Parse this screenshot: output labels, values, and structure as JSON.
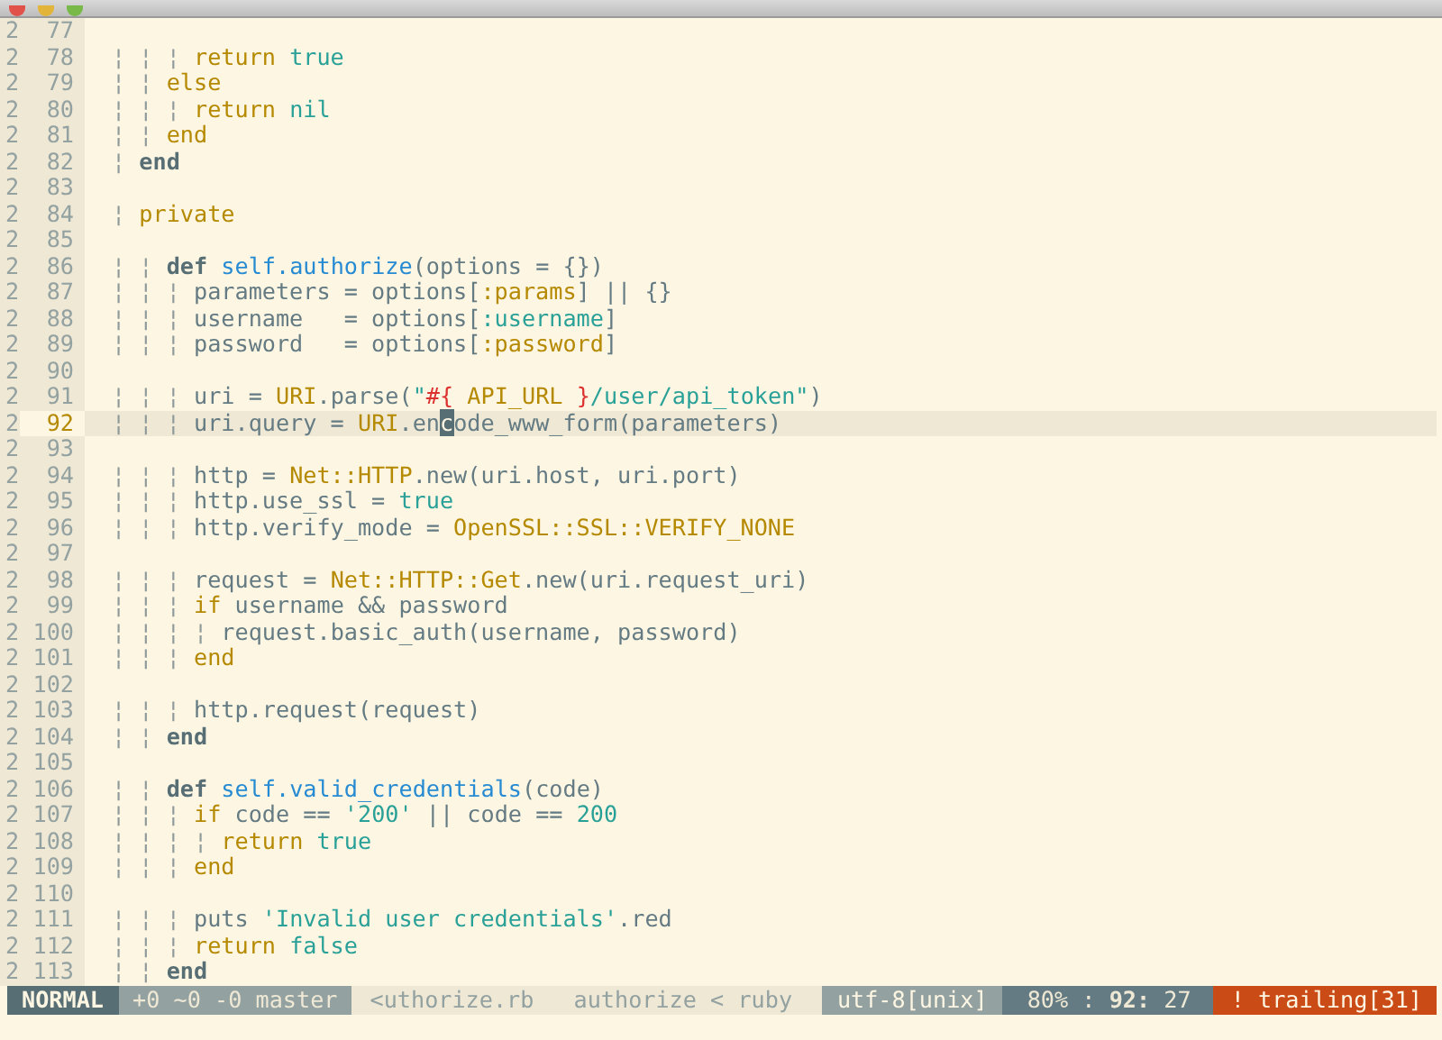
{
  "editor": {
    "lines": [
      {
        "sign": "2",
        "number": "77",
        "current": false
      },
      {
        "sign": "2",
        "number": "78",
        "current": false,
        "tokens": [
          {
            "kind": "guide",
            "text": "¦ ¦ ¦ "
          },
          {
            "kind": "keyword",
            "text": "return "
          },
          {
            "kind": "boolean",
            "text": "true"
          }
        ]
      },
      {
        "sign": "2",
        "number": "79",
        "current": false,
        "tokens": [
          {
            "kind": "guide",
            "text": "¦ ¦ "
          },
          {
            "kind": "keyword",
            "text": "else"
          }
        ]
      },
      {
        "sign": "2",
        "number": "80",
        "current": false,
        "tokens": [
          {
            "kind": "guide",
            "text": "¦ ¦ ¦ "
          },
          {
            "kind": "keyword",
            "text": "return "
          },
          {
            "kind": "boolean",
            "text": "nil"
          }
        ]
      },
      {
        "sign": "2",
        "number": "81",
        "current": false,
        "tokens": [
          {
            "kind": "guide",
            "text": "¦ ¦ "
          },
          {
            "kind": "keyword",
            "text": "end"
          }
        ]
      },
      {
        "sign": "2",
        "number": "82",
        "current": false,
        "tokens": [
          {
            "kind": "guide",
            "text": "¦ "
          },
          {
            "kind": "define",
            "text": "end"
          }
        ]
      },
      {
        "sign": "2",
        "number": "83",
        "current": false
      },
      {
        "sign": "2",
        "number": "84",
        "current": false,
        "tokens": [
          {
            "kind": "guide",
            "text": "¦ "
          },
          {
            "kind": "keyword",
            "text": "private"
          }
        ]
      },
      {
        "sign": "2",
        "number": "85",
        "current": false
      },
      {
        "sign": "2",
        "number": "86",
        "current": false,
        "tokens": [
          {
            "kind": "guide",
            "text": "¦ ¦ "
          },
          {
            "kind": "define",
            "text": "def "
          },
          {
            "kind": "method",
            "text": "self.authorize"
          },
          {
            "kind": "plain",
            "text": "(options = {})"
          }
        ]
      },
      {
        "sign": "2",
        "number": "87",
        "current": false,
        "tokens": [
          {
            "kind": "guide",
            "text": "¦ ¦ ¦ "
          },
          {
            "kind": "plain",
            "text": "parameters = options["
          },
          {
            "kind": "constant",
            "text": ":params"
          },
          {
            "kind": "plain",
            "text": "] || {}"
          }
        ]
      },
      {
        "sign": "2",
        "number": "88",
        "current": false,
        "tokens": [
          {
            "kind": "guide",
            "text": "¦ ¦ ¦ "
          },
          {
            "kind": "plain",
            "text": "username   = options["
          },
          {
            "kind": "boolean",
            "text": ":username"
          },
          {
            "kind": "plain",
            "text": "]"
          }
        ]
      },
      {
        "sign": "2",
        "number": "89",
        "current": false,
        "tokens": [
          {
            "kind": "guide",
            "text": "¦ ¦ ¦ "
          },
          {
            "kind": "plain",
            "text": "password   = options["
          },
          {
            "kind": "constant",
            "text": ":password"
          },
          {
            "kind": "plain",
            "text": "]"
          }
        ]
      },
      {
        "sign": "2",
        "number": "90",
        "current": false
      },
      {
        "sign": "2",
        "number": "91",
        "current": false,
        "tokens": [
          {
            "kind": "guide",
            "text": "¦ ¦ ¦ "
          },
          {
            "kind": "plain",
            "text": "uri = "
          },
          {
            "kind": "constant",
            "text": "URI"
          },
          {
            "kind": "plain",
            "text": ".parse("
          },
          {
            "kind": "string",
            "text": "\""
          },
          {
            "kind": "interpolation",
            "text": "#{"
          },
          {
            "kind": "constant",
            "text": " API_URL "
          },
          {
            "kind": "interpolation",
            "text": "}"
          },
          {
            "kind": "string",
            "text": "/user/api_token\""
          },
          {
            "kind": "plain",
            "text": ")"
          }
        ]
      },
      {
        "sign": "2",
        "number": "92",
        "current": true,
        "tokens": [
          {
            "kind": "guide",
            "text": "¦ ¦ ¦ "
          },
          {
            "kind": "plain",
            "text": "uri.query = "
          },
          {
            "kind": "constant",
            "text": "URI"
          },
          {
            "kind": "plain",
            "text": ".en"
          },
          {
            "kind": "cursor",
            "text": "c"
          },
          {
            "kind": "plain",
            "text": "ode_www_form(parameters)"
          }
        ]
      },
      {
        "sign": "2",
        "number": "93",
        "current": false
      },
      {
        "sign": "2",
        "number": "94",
        "current": false,
        "tokens": [
          {
            "kind": "guide",
            "text": "¦ ¦ ¦ "
          },
          {
            "kind": "plain",
            "text": "http = "
          },
          {
            "kind": "constant",
            "text": "Net::HTTP"
          },
          {
            "kind": "plain",
            "text": ".new(uri.host, uri.port)"
          }
        ]
      },
      {
        "sign": "2",
        "number": "95",
        "current": false,
        "tokens": [
          {
            "kind": "guide",
            "text": "¦ ¦ ¦ "
          },
          {
            "kind": "plain",
            "text": "http.use_ssl = "
          },
          {
            "kind": "boolean",
            "text": "true"
          }
        ]
      },
      {
        "sign": "2",
        "number": "96",
        "current": false,
        "tokens": [
          {
            "kind": "guide",
            "text": "¦ ¦ ¦ "
          },
          {
            "kind": "plain",
            "text": "http.verify_mode = "
          },
          {
            "kind": "constant",
            "text": "OpenSSL::SSL::VERIFY_NONE"
          }
        ]
      },
      {
        "sign": "2",
        "number": "97",
        "current": false
      },
      {
        "sign": "2",
        "number": "98",
        "current": false,
        "tokens": [
          {
            "kind": "guide",
            "text": "¦ ¦ ¦ "
          },
          {
            "kind": "plain",
            "text": "request = "
          },
          {
            "kind": "constant",
            "text": "Net::HTTP::Get"
          },
          {
            "kind": "plain",
            "text": ".new(uri.request_uri)"
          }
        ]
      },
      {
        "sign": "2",
        "number": "99",
        "current": false,
        "tokens": [
          {
            "kind": "guide",
            "text": "¦ ¦ ¦ "
          },
          {
            "kind": "keyword",
            "text": "if"
          },
          {
            "kind": "plain",
            "text": " username && password"
          }
        ]
      },
      {
        "sign": "2",
        "number": "100",
        "current": false,
        "tokens": [
          {
            "kind": "guide",
            "text": "¦ ¦ ¦ ¦ "
          },
          {
            "kind": "plain",
            "text": "request.basic_auth(username, password)"
          }
        ]
      },
      {
        "sign": "2",
        "number": "101",
        "current": false,
        "tokens": [
          {
            "kind": "guide",
            "text": "¦ ¦ ¦ "
          },
          {
            "kind": "keyword",
            "text": "end"
          }
        ]
      },
      {
        "sign": "2",
        "number": "102",
        "current": false
      },
      {
        "sign": "2",
        "number": "103",
        "current": false,
        "tokens": [
          {
            "kind": "guide",
            "text": "¦ ¦ ¦ "
          },
          {
            "kind": "plain",
            "text": "http.request(request)"
          }
        ]
      },
      {
        "sign": "2",
        "number": "104",
        "current": false,
        "tokens": [
          {
            "kind": "guide",
            "text": "¦ ¦ "
          },
          {
            "kind": "define",
            "text": "end"
          }
        ]
      },
      {
        "sign": "2",
        "number": "105",
        "current": false
      },
      {
        "sign": "2",
        "number": "106",
        "current": false,
        "tokens": [
          {
            "kind": "guide",
            "text": "¦ ¦ "
          },
          {
            "kind": "define",
            "text": "def "
          },
          {
            "kind": "method",
            "text": "self.valid_credentials"
          },
          {
            "kind": "plain",
            "text": "(code)"
          }
        ]
      },
      {
        "sign": "2",
        "number": "107",
        "current": false,
        "tokens": [
          {
            "kind": "guide",
            "text": "¦ ¦ ¦ "
          },
          {
            "kind": "keyword",
            "text": "if"
          },
          {
            "kind": "plain",
            "text": " code == "
          },
          {
            "kind": "string",
            "text": "'200'"
          },
          {
            "kind": "plain",
            "text": " || code == "
          },
          {
            "kind": "boolean",
            "text": "200"
          }
        ]
      },
      {
        "sign": "2",
        "number": "108",
        "current": false,
        "tokens": [
          {
            "kind": "guide",
            "text": "¦ ¦ ¦ ¦ "
          },
          {
            "kind": "keyword",
            "text": "return "
          },
          {
            "kind": "boolean",
            "text": "true"
          }
        ]
      },
      {
        "sign": "2",
        "number": "109",
        "current": false,
        "tokens": [
          {
            "kind": "guide",
            "text": "¦ ¦ ¦ "
          },
          {
            "kind": "keyword",
            "text": "end"
          }
        ]
      },
      {
        "sign": "2",
        "number": "110",
        "current": false
      },
      {
        "sign": "2",
        "number": "111",
        "current": false,
        "tokens": [
          {
            "kind": "guide",
            "text": "¦ ¦ ¦ "
          },
          {
            "kind": "plain",
            "text": "puts "
          },
          {
            "kind": "string",
            "text": "'Invalid user credentials'"
          },
          {
            "kind": "plain",
            "text": ".red"
          }
        ]
      },
      {
        "sign": "2",
        "number": "112",
        "current": false,
        "tokens": [
          {
            "kind": "guide",
            "text": "¦ ¦ ¦ "
          },
          {
            "kind": "keyword",
            "text": "return "
          },
          {
            "kind": "boolean",
            "text": "false"
          }
        ]
      },
      {
        "sign": "2",
        "number": "113",
        "current": false,
        "tokens": [
          {
            "kind": "guide",
            "text": "¦ ¦ "
          },
          {
            "kind": "define",
            "text": "end"
          }
        ]
      }
    ]
  },
  "status_bar": [
    {
      "kind": "mode",
      "text": "NORMAL"
    },
    {
      "kind": "git",
      "text": "+0 ~0 -0 master"
    },
    {
      "kind": "file",
      "text": "<uthorize.rb"
    },
    {
      "kind": "function",
      "text": "authorize < ruby"
    },
    {
      "kind": "encoding",
      "text": "utf-8[unix]"
    },
    {
      "kind": "position",
      "text": "80% : **92:** 27"
    },
    {
      "kind": "warning",
      "text": "! trailing[31]"
    }
  ]
}
